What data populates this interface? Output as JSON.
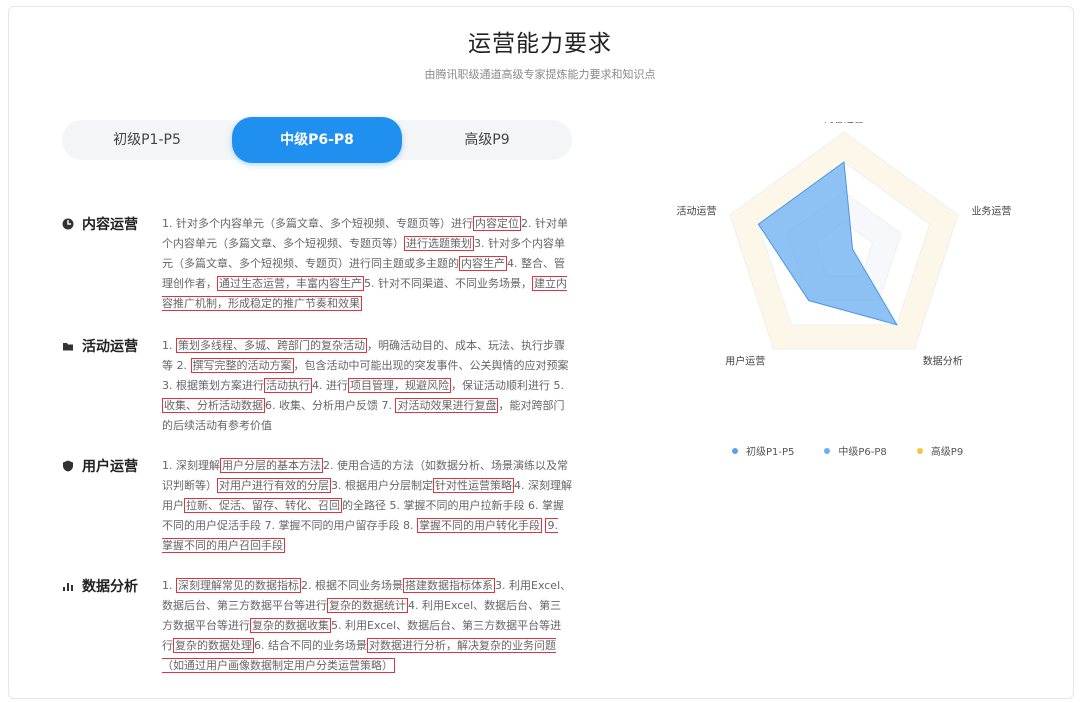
{
  "page": {
    "title": "运营能力要求",
    "subtitle": "由腾讯职级通道高级专家提炼能力要求和知识点"
  },
  "tabs": [
    {
      "label": "初级P1-P5"
    },
    {
      "label": "中级P6-P8"
    },
    {
      "label": "高级P9"
    }
  ],
  "sections": [
    {
      "title": "内容运营",
      "icon": "content-icon",
      "parts": [
        {
          "t": "1. 针对多个内容单元（多篇文章、多个短视频、专题页等）进行"
        },
        {
          "t": "内容定位",
          "hl": true
        },
        {
          "t": "2. 针对单个内容单元（多篇文章、多个短视频、专题页等）"
        },
        {
          "t": "进行选题策划",
          "hl": true
        },
        {
          "t": "3. 针对多个内容单元（多篇文章、多个短视频、专题页）进行同主题或多主题的"
        },
        {
          "t": "内容生产",
          "hl": true
        },
        {
          "t": "4. 整合、管理创作者，"
        },
        {
          "t": "通过生态运营，丰富内容生产",
          "hl": true
        },
        {
          "t": "5. 针对不同渠道、不同业务场景，"
        },
        {
          "t": "建立内容推广机制，形成稳定的推广节奏和效果",
          "hl": true
        }
      ]
    },
    {
      "title": "活动运营",
      "icon": "activity-icon",
      "parts": [
        {
          "t": "1. "
        },
        {
          "t": "策划多线程、多城、跨部门的复杂活动",
          "hl": true
        },
        {
          "t": "，明确活动目的、成本、玩法、执行步骤等 2. "
        },
        {
          "t": "撰写完整的活动方案",
          "hl": true
        },
        {
          "t": "，包含活动中可能出现的突发事件、公关舆情的应对预案 3. 根据策划方案进行"
        },
        {
          "t": "活动执行",
          "hl": true
        },
        {
          "t": "4. 进行"
        },
        {
          "t": "项目管理，规避风险",
          "hl": true
        },
        {
          "t": "，保证活动顺利进行 5. "
        },
        {
          "t": "收集、分析活动数据",
          "hl": true
        },
        {
          "t": "6. 收集、分析用户反馈 7. "
        },
        {
          "t": "对活动效果进行复盘",
          "hl": true
        },
        {
          "t": "，能对跨部门的后续活动有参考价值"
        }
      ]
    },
    {
      "title": "用户运营",
      "icon": "user-icon",
      "parts": [
        {
          "t": "1. 深刻理解"
        },
        {
          "t": "用户分层的基本方法",
          "hl": true
        },
        {
          "t": "2. 使用合适的方法（如数据分析、场景演练以及常识判断等）"
        },
        {
          "t": "对用户进行有效的分层",
          "hl": true
        },
        {
          "t": "3. 根据用户分层制定"
        },
        {
          "t": "针对性运营策略",
          "hl": true
        },
        {
          "t": "4. 深刻理解用户"
        },
        {
          "t": "拉新、促活、留存、转化、召回",
          "hl": true
        },
        {
          "t": "的全路径 5. 掌握不同的用户拉新手段 6. 掌握不同的用户促活手段 7. 掌握不同的用户留存手段 8. "
        },
        {
          "t": "掌握不同的用户转化手段",
          "hl": true
        },
        {
          "t": " "
        },
        {
          "t": "9. 掌握不同的用户召回手段",
          "hl": true
        }
      ]
    },
    {
      "title": "数据分析",
      "icon": "data-icon",
      "parts": [
        {
          "t": "1. "
        },
        {
          "t": "深刻理解常见的数据指标",
          "hl": true
        },
        {
          "t": "2. 根据不同业务场景"
        },
        {
          "t": "搭建数据指标体系",
          "hl": true
        },
        {
          "t": "3. 利用Excel、数据后台、第三方数据平台等进行"
        },
        {
          "t": "复杂的数据统计",
          "hl": true
        },
        {
          "t": "4. 利用Excel、数据后台、第三方数据平台等进行"
        },
        {
          "t": "复杂的数据收集",
          "hl": true
        },
        {
          "t": "5. 利用Excel、数据后台、第三方数据平台等进行"
        },
        {
          "t": "复杂的数据处理",
          "hl": true
        },
        {
          "t": "6. 结合不同的业务场景"
        },
        {
          "t": "对数据进行分析，解决复杂的业务问题（如通过用户画像数据制定用户分类运营策略）",
          "hl": true
        }
      ]
    }
  ],
  "radar": {
    "axes": [
      "内容运营",
      "业务运营",
      "数据分析",
      "用户运营",
      "活动运营"
    ],
    "levels": 4,
    "max": 4,
    "series_values": [
      3,
      0.3,
      3,
      2,
      3
    ],
    "fill_color": "#6aaef0",
    "ring_colors": [
      "#fdf7ea",
      "#ffffff",
      "#f6f8fb",
      "#ffffff"
    ]
  },
  "legend": [
    {
      "label": "初级P1-P5",
      "color": "#5aa3e8"
    },
    {
      "label": "中级P6-P8",
      "color": "#6aaef0"
    },
    {
      "label": "高级P9",
      "color": "#f5c542"
    }
  ],
  "colors": {
    "accent": "#1f8ff0",
    "highlight": "#e0323f"
  }
}
